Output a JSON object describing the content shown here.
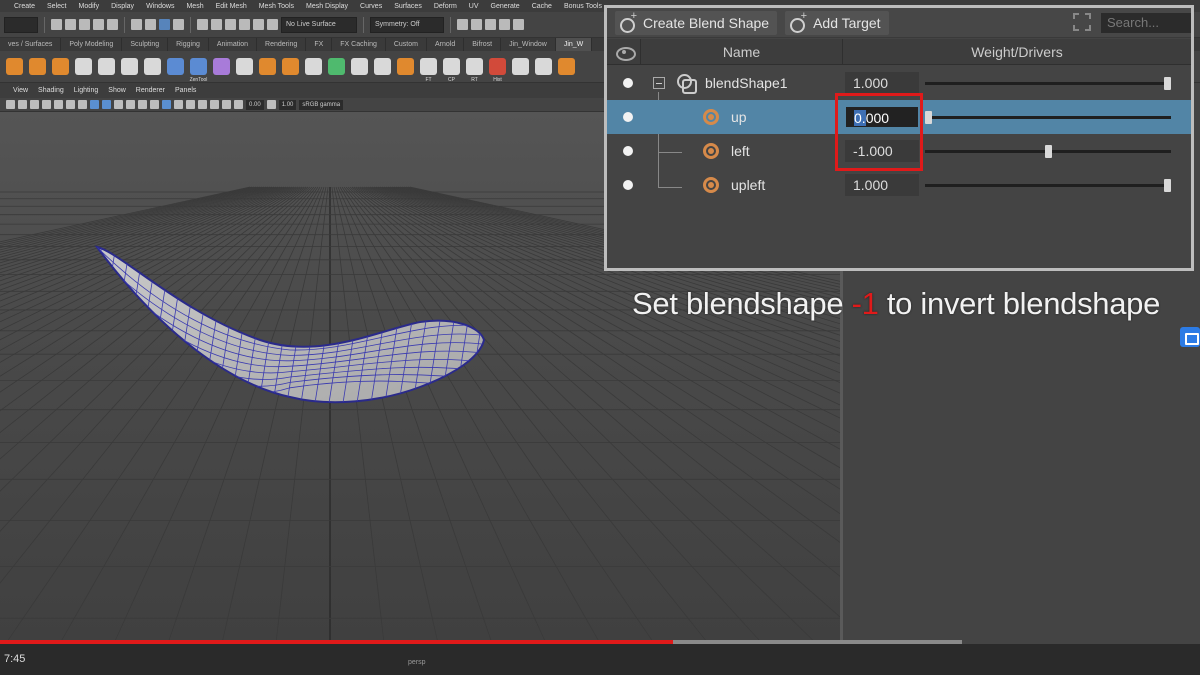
{
  "menubar": [
    "Create",
    "Select",
    "Modify",
    "Display",
    "Windows",
    "Mesh",
    "Edit Mesh",
    "Mesh Tools",
    "Mesh Display",
    "Curves",
    "Surfaces",
    "Deform",
    "UV",
    "Generate",
    "Cache",
    "Bonus Tools"
  ],
  "statusline": {
    "live_surface": "No Live Surface",
    "symmetry": "Symmetry: Off"
  },
  "shelf_tabs": [
    "ves / Surfaces",
    "Poly Modeling",
    "Sculpting",
    "Rigging",
    "Animation",
    "Rendering",
    "FX",
    "FX Caching",
    "Custom",
    "Arnold",
    "Bifrost",
    "Jin_Window",
    "Jin_W"
  ],
  "shelf_labels": {
    "zentool": "ZenTool",
    "ft": "FT",
    "cp": "CP",
    "rt": "RT",
    "hist": "Hist"
  },
  "panel_menu": [
    "View",
    "Shading",
    "Lighting",
    "Show",
    "Renderer",
    "Panels"
  ],
  "viewport_toolbar": {
    "value1": "0.00",
    "value2": "1.00",
    "colorspace": "sRGB gamma"
  },
  "shape_editor": {
    "create_blend_shape": "Create Blend Shape",
    "add_target": "Add Target",
    "search_placeholder": "Search...",
    "col_name": "Name",
    "col_weight": "Weight/Drivers",
    "rows": [
      {
        "name": "blendShape1",
        "value": "1.000",
        "slider": 1.0
      },
      {
        "name": "up",
        "value_selected": "0.",
        "value_rest": "000",
        "slider": 0.0
      },
      {
        "name": "left",
        "value": "-1.000",
        "slider": 0.5
      },
      {
        "name": "upleft",
        "value": "1.000",
        "slider": 1.0
      }
    ]
  },
  "caption": {
    "before": "Set blendshape ",
    "highlight": "-1",
    "after": " to invert blendshape"
  },
  "video": {
    "time": "7:45",
    "progress": 0.7,
    "camera": "persp"
  },
  "colors": {
    "accent_red": "#e01a1a",
    "selection_blue": "#5285a6"
  }
}
